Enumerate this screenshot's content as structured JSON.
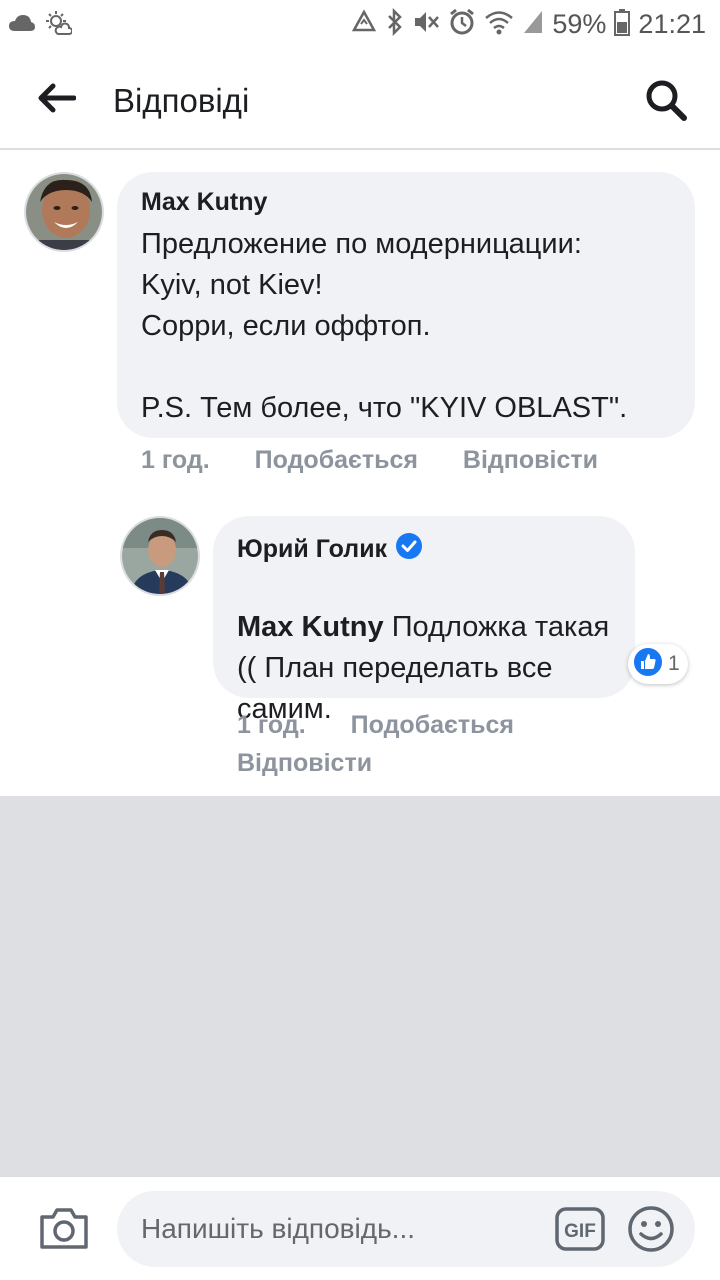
{
  "status_bar": {
    "battery": "59%",
    "time": "21:21",
    "icons": [
      "cloud-icon",
      "sun-weather-icon",
      "recycle-icon",
      "bluetooth-icon",
      "mute-icon",
      "alarm-icon",
      "wifi-icon",
      "signal-icon",
      "battery-icon"
    ]
  },
  "header": {
    "title": "Відповіді",
    "back_icon": "back-arrow-icon",
    "search_icon": "search-icon"
  },
  "comments": [
    {
      "author": "Max Kutny",
      "text": "Предложение по модерницации:\nKyiv, not Kiev!\nСорри, если оффтоп.\n\nP.S. Тем более, что \"KYIV OBLAST\".",
      "time": "1 год.",
      "like": "Подобається",
      "reply": "Відповісти"
    },
    {
      "author": "Юрий Голик",
      "verified": true,
      "mention": "Max Kutny",
      "text": " Подложка такая (( План переделать все самим.",
      "time": "1 год.",
      "like": "Подобається",
      "reply": "Відповісти",
      "reaction_count": "1",
      "reaction_icon": "like-reaction-icon"
    }
  ],
  "composer": {
    "placeholder": "Напишіть відповідь...",
    "camera_icon": "camera-icon",
    "gif_icon": "gif-icon",
    "emoji_icon": "emoji-icon"
  },
  "colors": {
    "accent": "#1877f2",
    "bubble": "#f0f2f5",
    "meta_text": "#8d949e",
    "empty_area": "#dddfe2"
  }
}
